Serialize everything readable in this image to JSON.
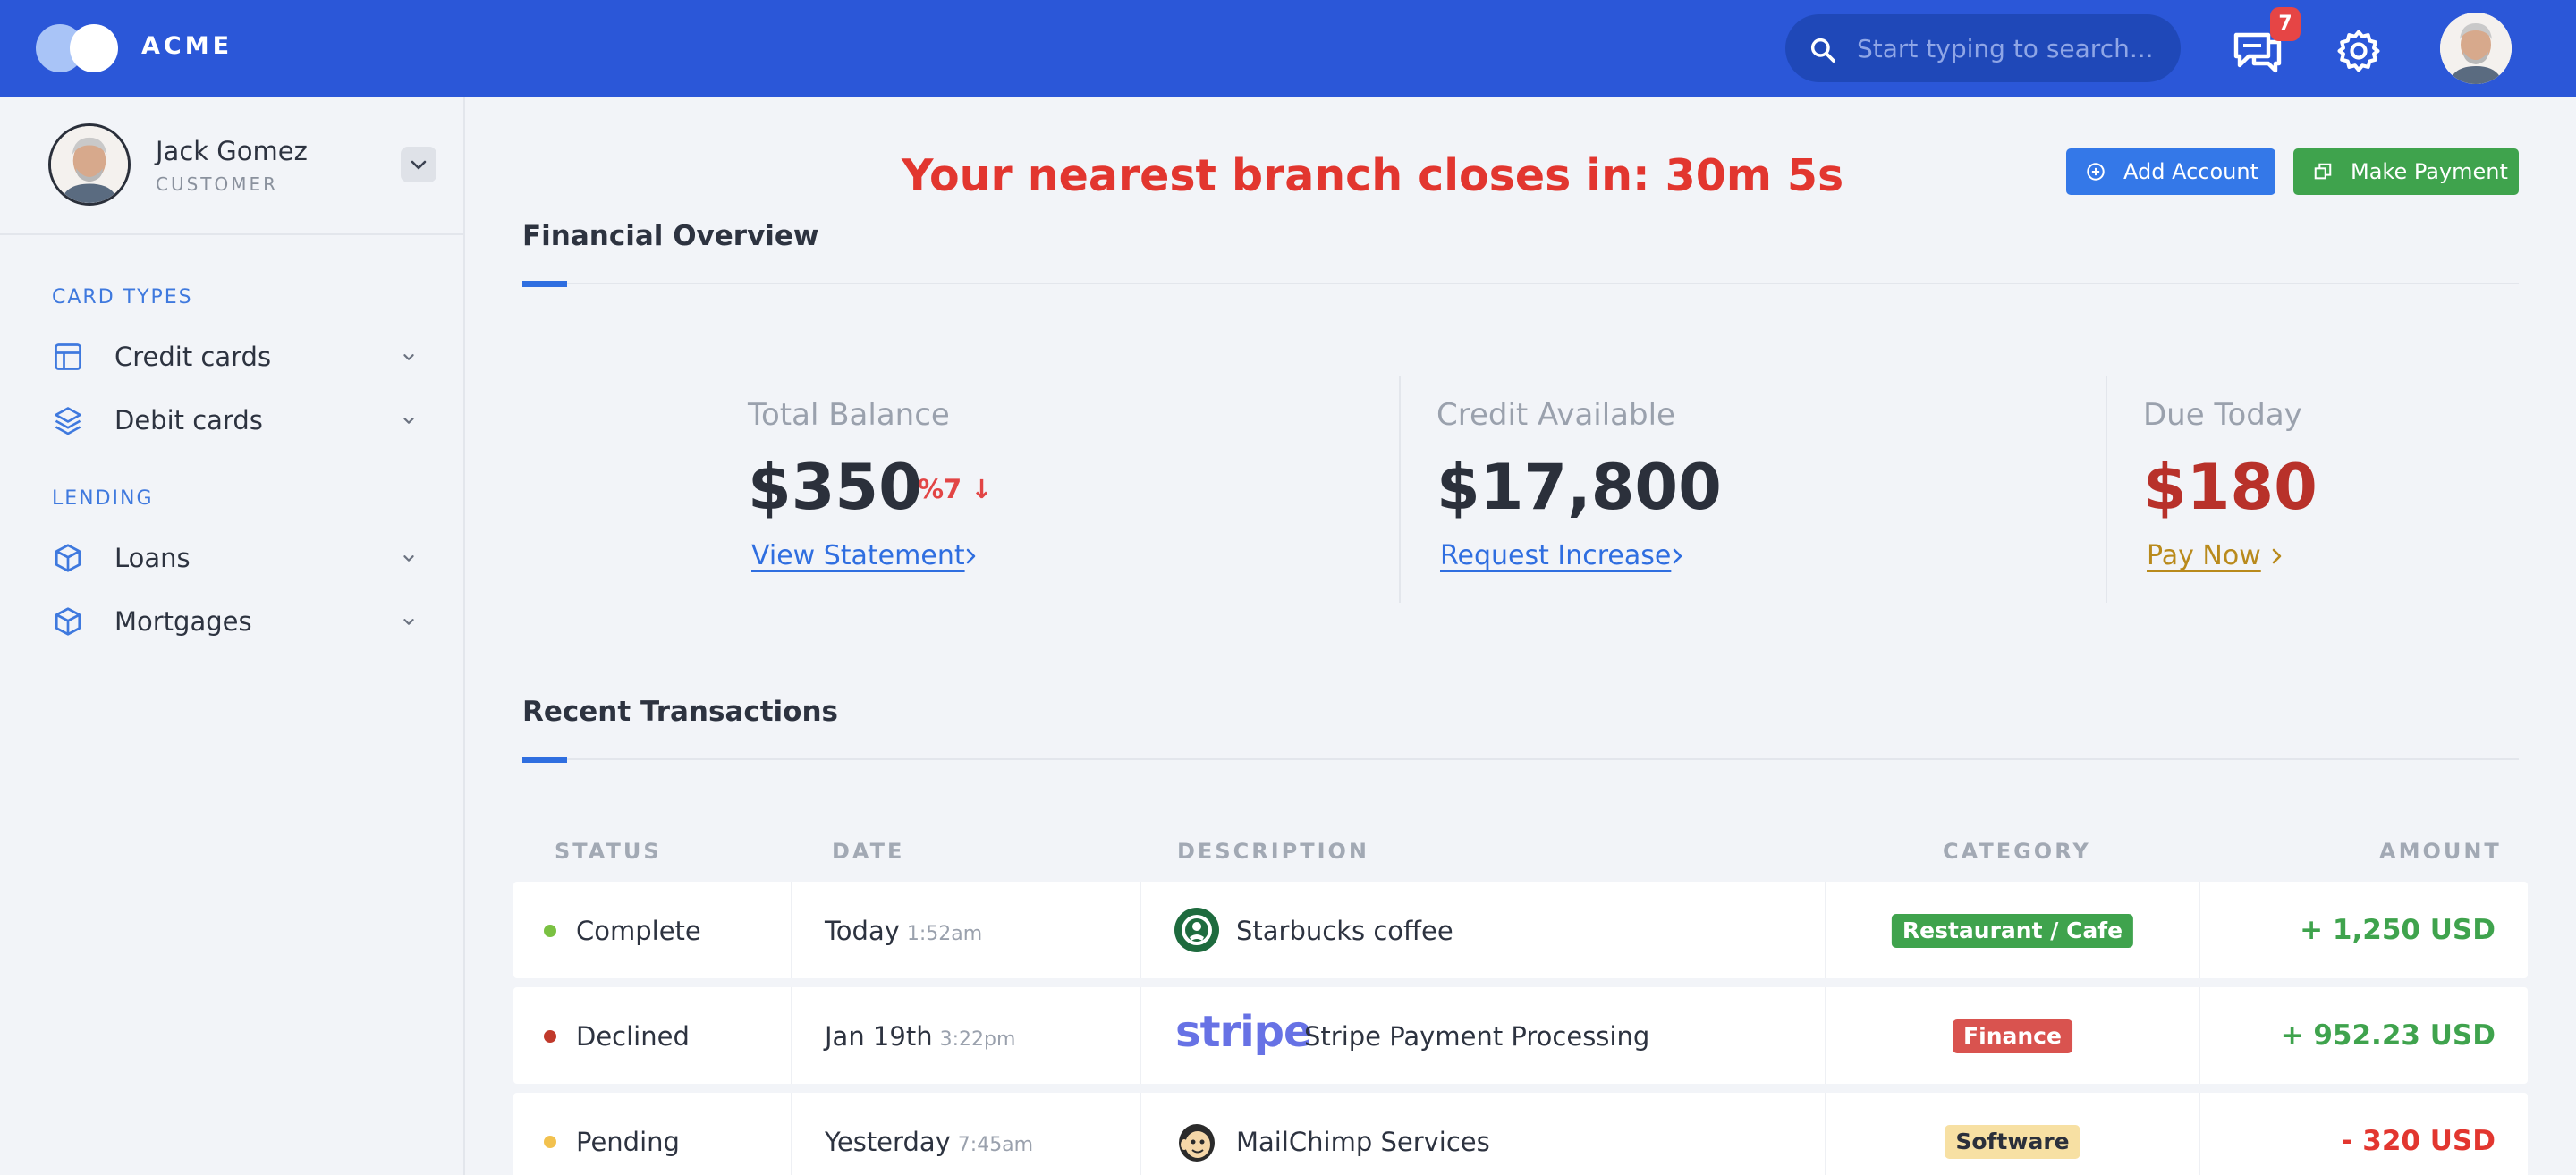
{
  "header": {
    "brand": "ACME",
    "search_placeholder": "Start typing to search...",
    "notification_count": "7"
  },
  "user": {
    "name": "Jack Gomez",
    "role": "CUSTOMER"
  },
  "sidebar": {
    "sections": [
      {
        "title": "CARD TYPES",
        "items": [
          {
            "label": "Credit cards",
            "icon": "layout-icon"
          },
          {
            "label": "Debit cards",
            "icon": "layers-icon"
          }
        ]
      },
      {
        "title": "LENDING",
        "items": [
          {
            "label": "Loans",
            "icon": "box-icon"
          },
          {
            "label": "Mortgages",
            "icon": "box-icon"
          }
        ]
      }
    ]
  },
  "main": {
    "countdown": "Your nearest branch closes in: 30m 5s",
    "actions": {
      "add_account": "Add Account",
      "make_payment": "Make Payment"
    },
    "overview_title": "Financial Overview",
    "stats": [
      {
        "label": "Total Balance",
        "value": "$350",
        "trend": "%7 ↓",
        "link": "View Statement"
      },
      {
        "label": "Credit Available",
        "value": "$17,800",
        "link": "Request Increase"
      },
      {
        "label": "Due Today",
        "value": "$180",
        "link": "Pay Now"
      }
    ],
    "transactions_title": "Recent Transactions",
    "table": {
      "headers": [
        "STATUS",
        "DATE",
        "DESCRIPTION",
        "CATEGORY",
        "AMOUNT"
      ],
      "rows": [
        {
          "status": "Complete",
          "status_color": "#7ac142",
          "date": "Today",
          "time": "1:52am",
          "description": "Starbucks coffee",
          "logo": "starbucks",
          "category": "Restaurant / Cafe",
          "category_style": "green",
          "amount": "+ 1,250 USD",
          "amount_color": "#3fa34d"
        },
        {
          "status": "Declined",
          "status_color": "#c0392b",
          "date": "Jan 19th",
          "time": "3:22pm",
          "description": "Stripe Payment Processing",
          "logo": "stripe",
          "logo_text": "stripe",
          "category": "Finance",
          "category_style": "red",
          "amount": "+ 952.23 USD",
          "amount_color": "#3fa34d"
        },
        {
          "status": "Pending",
          "status_color": "#f2c14e",
          "date": "Yesterday",
          "time": "7:45am",
          "description": "MailChimp Services",
          "logo": "mailchimp",
          "category": "Software",
          "category_style": "yellow",
          "amount": "- 320 USD",
          "amount_color": "#e2362f"
        }
      ]
    }
  },
  "colors": {
    "topbar": "#2b57d8",
    "accent": "#2f6ee0",
    "danger": "#e2362f",
    "success": "#3fa34d",
    "due": "#b8312a",
    "pay_link": "#b98a1c"
  }
}
